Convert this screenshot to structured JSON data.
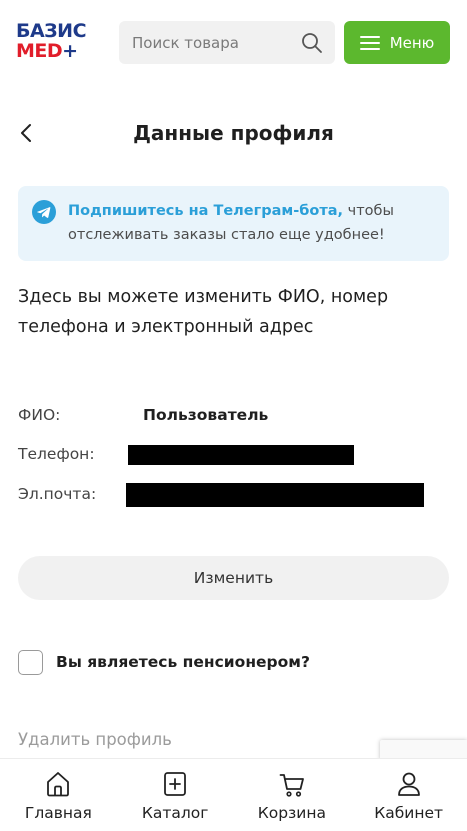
{
  "header": {
    "logo_line1": "БАЗИС",
    "logo_line2": "MED",
    "logo_plus": "+",
    "search_placeholder": "Поиск товара",
    "menu_label": "Меню"
  },
  "page": {
    "title": "Данные профиля"
  },
  "telegram_banner": {
    "link_text": "Подпишитесь на Телеграм-бота,",
    "rest_text": " чтобы отслеживать заказы стало еще удобнее!"
  },
  "intro_text": "Здесь вы можете изменить ФИО, номер телефона и электронный адрес",
  "profile": {
    "fio_label": "ФИО:",
    "fio_value": "Пользователь",
    "phone_label": "Телефон:",
    "email_label": "Эл.почта:"
  },
  "change_button": "Изменить",
  "pensioner_question": "Вы являетесь пенсионером?",
  "delete_profile": "Удалить профиль",
  "bottom_nav": [
    {
      "label": "Главная",
      "icon": "home-icon"
    },
    {
      "label": "Каталог",
      "icon": "catalog-icon"
    },
    {
      "label": "Корзина",
      "icon": "cart-icon"
    },
    {
      "label": "Кабинет",
      "icon": "user-icon"
    }
  ],
  "colors": {
    "accent_green": "#5cb82e",
    "telegram_blue": "#2b9fd8",
    "logo_blue": "#1e3a8a",
    "logo_red": "#e11d2a",
    "banner_bg": "#e9f4fb"
  }
}
